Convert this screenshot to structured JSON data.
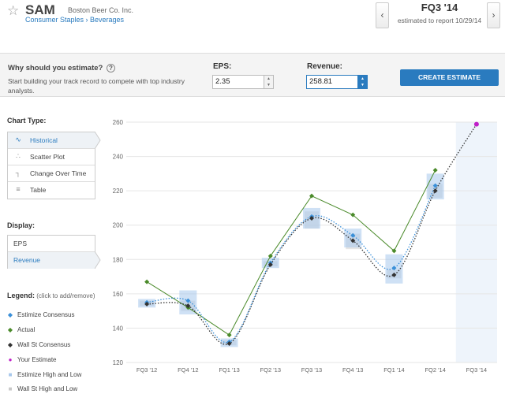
{
  "header": {
    "ticker": "SAM",
    "company": "Boston Beer Co. Inc.",
    "breadcrumb": "Consumer Staples › Beverages",
    "quarter": "FQ3 '14",
    "report_date": "estimated to report 10/29/14",
    "prev_glyph": "‹",
    "next_glyph": "›",
    "star_glyph": "☆"
  },
  "estimate": {
    "question": "Why should you estimate?",
    "help_glyph": "?",
    "subtext": "Start building your track record to compete with top industry analysts.",
    "eps_label": "EPS:",
    "eps_value": "2.35",
    "revenue_label": "Revenue:",
    "revenue_value": "258.81",
    "create_label": "CREATE ESTIMATE"
  },
  "sidebar": {
    "chart_type_label": "Chart Type:",
    "chart_types": [
      {
        "label": "Historical",
        "icon": "wave-icon",
        "glyph": "∿"
      },
      {
        "label": "Scatter Plot",
        "icon": "scatter-icon",
        "glyph": "∴"
      },
      {
        "label": "Change Over Time",
        "icon": "step-icon",
        "glyph": "┐"
      },
      {
        "label": "Table",
        "icon": "table-icon",
        "glyph": "≡"
      }
    ],
    "display_label": "Display:",
    "display_options": [
      "EPS",
      "Revenue"
    ],
    "legend_label": "Legend:",
    "legend_hint": "(click to add/remove)",
    "legend": [
      {
        "label": "Estimize Consensus",
        "color": "#3a8fd8",
        "glyph": "◆"
      },
      {
        "label": "Actual",
        "color": "#4a8a2a",
        "glyph": "◆"
      },
      {
        "label": "Wall St Consensus",
        "color": "#333333",
        "glyph": "◆"
      },
      {
        "label": "Your Estimate",
        "color": "#c020c8",
        "glyph": "●"
      },
      {
        "label": "Estimize High and Low",
        "color": "#a8c8ec",
        "glyph": "■"
      },
      {
        "label": "Wall St High and Low",
        "color": "#c8c8c8",
        "glyph": "■"
      }
    ]
  },
  "chart_data": {
    "type": "line",
    "categories": [
      "FQ3 '12",
      "FQ4 '12",
      "FQ1 '13",
      "FQ2 '13",
      "FQ3 '13",
      "FQ4 '13",
      "FQ1 '14",
      "FQ2 '14",
      "FQ3 '14"
    ],
    "ylim": [
      120,
      260
    ],
    "yticks": [
      120,
      140,
      160,
      180,
      200,
      220,
      240,
      260
    ],
    "series": [
      {
        "name": "Actual",
        "color": "#4a8a2a",
        "values": [
          167,
          152,
          136,
          182,
          217,
          206,
          185,
          232,
          null
        ]
      },
      {
        "name": "Estimize Consensus",
        "color": "#3a8fd8",
        "values": [
          155,
          156,
          132,
          178,
          205,
          194,
          175,
          223,
          null
        ]
      },
      {
        "name": "Wall St Consensus",
        "color": "#333333",
        "values": [
          154,
          153,
          131,
          177,
          204,
          191,
          171,
          220,
          null
        ]
      },
      {
        "name": "Your Estimate",
        "color": "#c020c8",
        "values": [
          null,
          null,
          null,
          null,
          null,
          null,
          null,
          null,
          258.81
        ]
      }
    ],
    "estimize_range": [
      [
        152,
        157
      ],
      [
        148,
        162
      ],
      [
        129,
        134
      ],
      [
        175,
        181
      ],
      [
        198,
        210
      ],
      [
        187,
        198
      ],
      [
        166,
        183
      ],
      [
        215,
        230
      ],
      null
    ],
    "wallst_range": [
      [
        153,
        156
      ],
      [
        150,
        156
      ],
      [
        130,
        133
      ],
      [
        176,
        179
      ],
      [
        198,
        208
      ],
      [
        186,
        195
      ],
      [
        169,
        174
      ],
      [
        216,
        224
      ],
      null
    ],
    "highlight_category": "FQ3 '14",
    "grid": true
  }
}
